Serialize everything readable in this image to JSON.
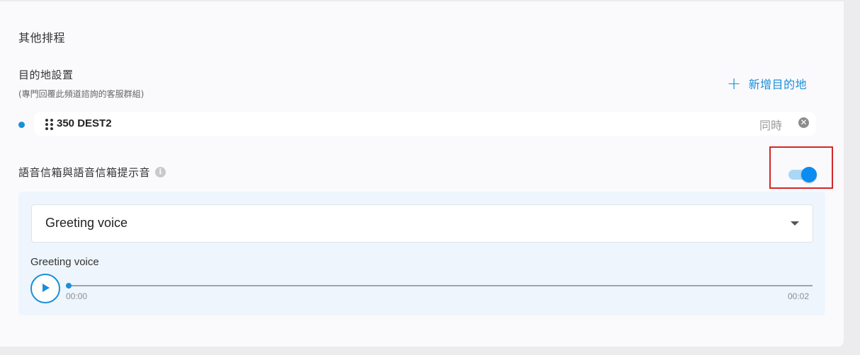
{
  "section": {
    "title": "其他排程"
  },
  "destination": {
    "label": "目的地設置",
    "sublabel": "(專門回覆此頻道諮詢的客服群組)",
    "add_label": "新增目的地",
    "add_icon": "plus-icon",
    "items": [
      {
        "name": "350 DEST2",
        "mode": "同時",
        "remove_icon": "close-circle-icon",
        "drag_icon": "drag-handle-icon"
      }
    ]
  },
  "voicemail": {
    "label": "語音信箱與語音信箱提示音",
    "info_icon": "info-icon",
    "toggle_on": true,
    "select_value": "Greeting voice",
    "audio_label": "Greeting voice",
    "current_time": "00:00",
    "duration": "00:02",
    "progress_fraction": 0.0
  },
  "colors": {
    "accent": "#1a8fd8",
    "toggle_knob": "#0b8cf0",
    "toggle_track": "#a9d8f6",
    "highlight": "#d3262b",
    "panel_bg": "#eef5fd"
  }
}
